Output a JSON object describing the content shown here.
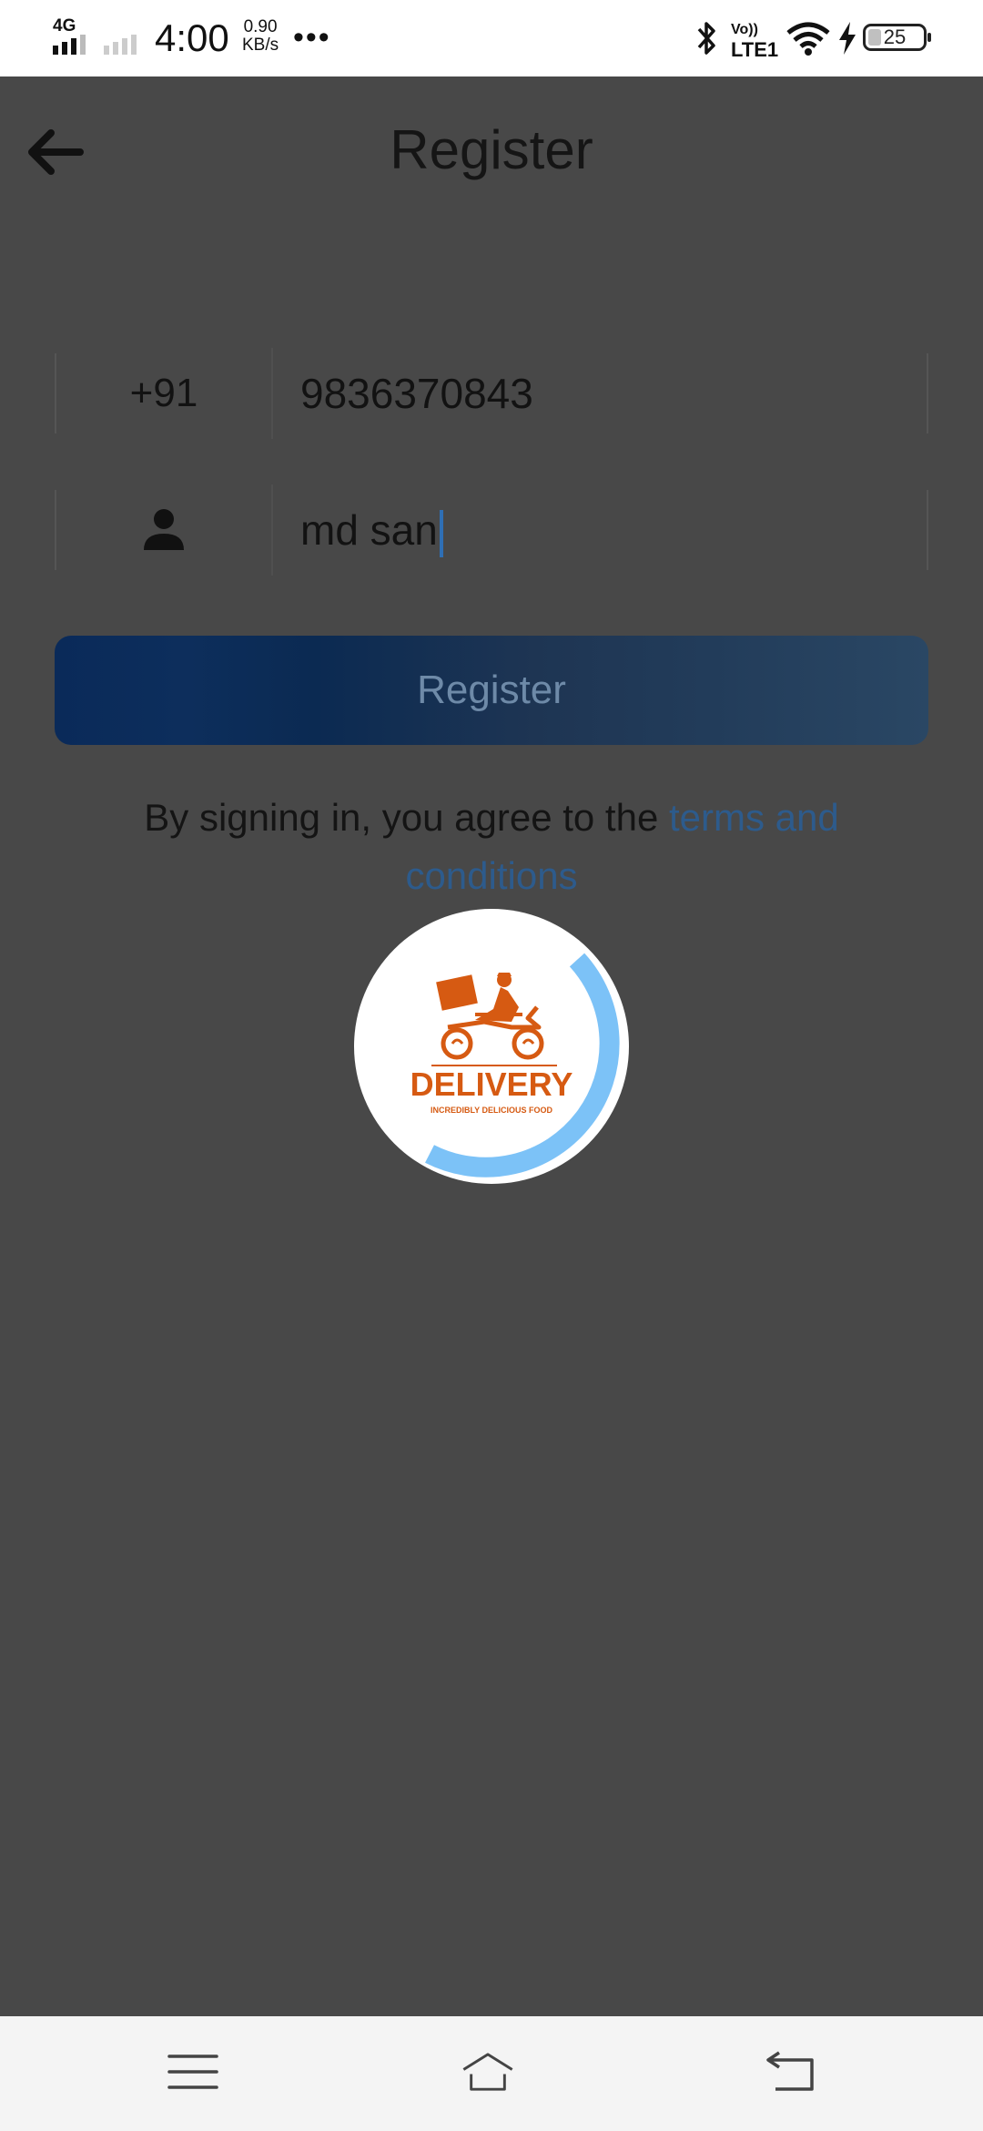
{
  "status_bar": {
    "network": "4G",
    "time": "4:00",
    "speed_value": "0.90",
    "speed_unit": "KB/s",
    "more": "•••",
    "volte": "Vo))",
    "lte": "LTE1",
    "battery": "25"
  },
  "header": {
    "title": "Register",
    "back_icon": "arrow-left-icon"
  },
  "form": {
    "country_code": "+91",
    "phone": "9836370843",
    "name": "md san",
    "name_icon": "person-icon"
  },
  "register_button": {
    "label": "Register"
  },
  "terms": {
    "text": "By signing in, you agree to the ",
    "link": "terms and conditions",
    "link_color": "#2d5b8c"
  },
  "loader": {
    "brand": "DELIVERY",
    "tagline": "INCREDIBLY DELICIOUS FOOD",
    "arc_color": "#7cc2f7",
    "brand_color": "#d65a12"
  },
  "nav_bar": {
    "icons": [
      "menu-icon",
      "home-icon",
      "back-icon"
    ]
  }
}
